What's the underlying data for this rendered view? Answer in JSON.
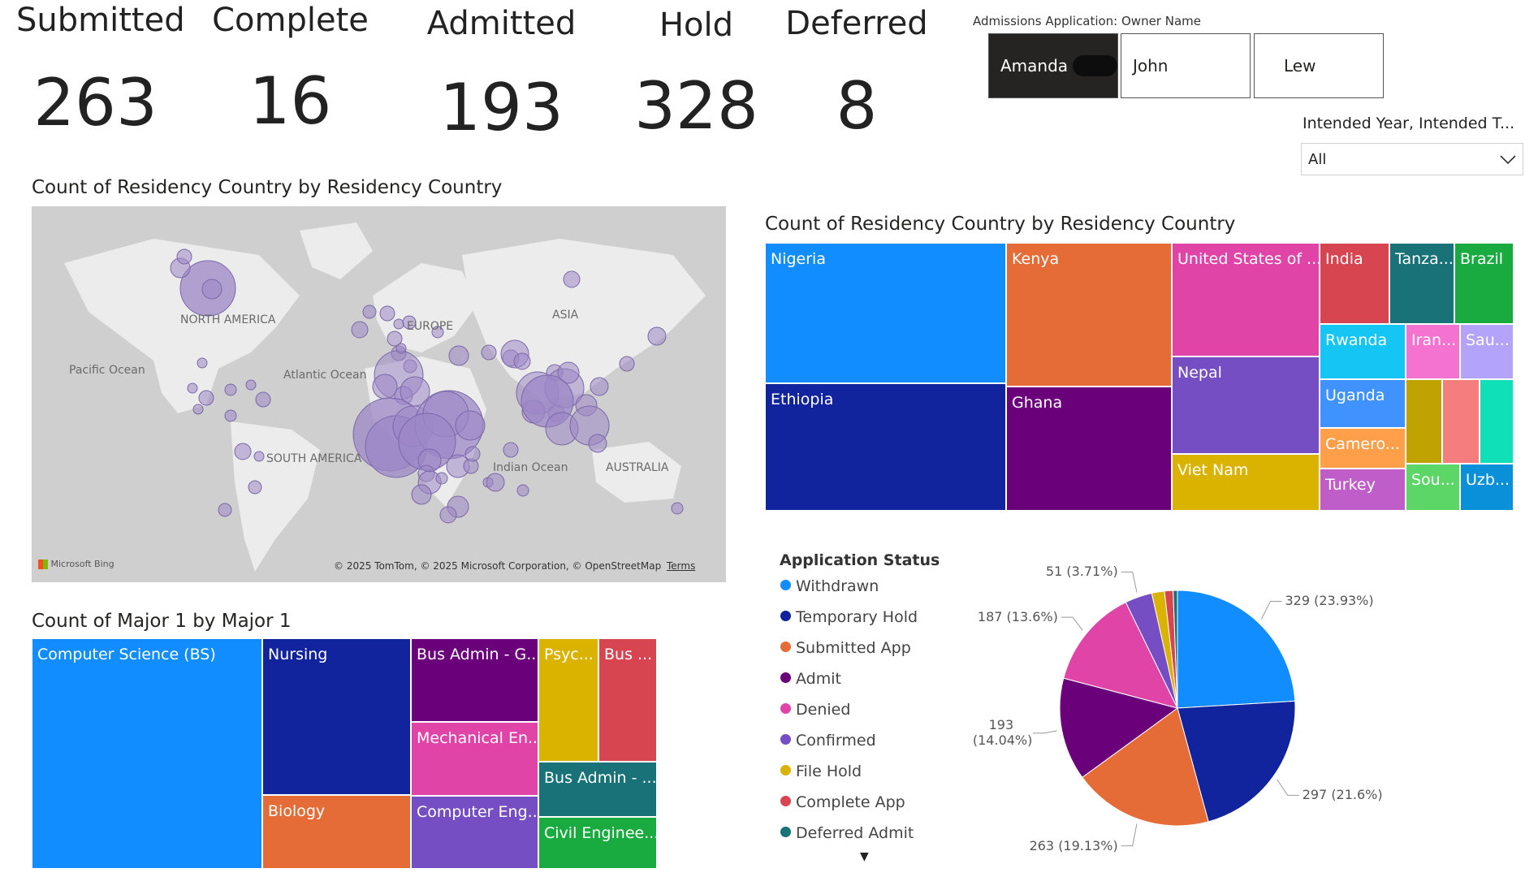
{
  "kpis": [
    {
      "label": "Submitted",
      "value": "263"
    },
    {
      "label": "Complete",
      "value": "16"
    },
    {
      "label": "Admitted",
      "value": "193"
    },
    {
      "label": "Hold",
      "value": "328"
    },
    {
      "label": "Deferred",
      "value": "8"
    }
  ],
  "owner_slicer": {
    "title": "Admissions Application: Owner Name",
    "options": [
      "Amanda",
      "John",
      "Lew"
    ],
    "selected": "Amanda"
  },
  "year_slicer": {
    "title": "Intended Year, Intended T...",
    "value": "All"
  },
  "map_visual": {
    "title": "Count of Residency Country by Residency Country",
    "labels": {
      "north_america": "NORTH AMERICA",
      "europe": "EUROPE",
      "asia": "ASIA",
      "pacific": "Pacific Ocean",
      "atlantic": "Atlantic Ocean",
      "south_america": "SOUTH AMERICA",
      "indian": "Indian Ocean",
      "australia": "AUSTRALIA"
    },
    "logo": "Microsoft Bing",
    "copyright": "© 2025 TomTom, © 2025 Microsoft Corporation, © OpenStreetMap",
    "terms": "Terms",
    "bubble_color": "#9c87c7"
  },
  "country_treemap": {
    "title": "Count of Residency Country by Residency Country",
    "tiles": [
      {
        "label": "Nigeria",
        "color": "#118dff"
      },
      {
        "label": "Ethiopia",
        "color": "#12239e"
      },
      {
        "label": "Kenya",
        "color": "#e66c37"
      },
      {
        "label": "Ghana",
        "color": "#6b007b"
      },
      {
        "label": "United States of ...",
        "color": "#e044a7"
      },
      {
        "label": "Nepal",
        "color": "#744ec2"
      },
      {
        "label": "Viet Nam",
        "color": "#d9b300"
      },
      {
        "label": "India",
        "color": "#d64550"
      },
      {
        "label": "Tanza...",
        "color": "#197278"
      },
      {
        "label": "Brazil",
        "color": "#1aab40"
      },
      {
        "label": "Rwanda",
        "color": "#15c6f4"
      },
      {
        "label": "Iran...",
        "color": "#f472d0"
      },
      {
        "label": "Sau...",
        "color": "#b3a4fa"
      },
      {
        "label": "Uganda",
        "color": "#4092ff"
      },
      {
        "label": "Camero...",
        "color": "#ff9f4a"
      },
      {
        "label": "Turkey",
        "color": "#c05ec9"
      },
      {
        "label": "",
        "color": "#c0a200"
      },
      {
        "label": "",
        "color": "#f57d7d"
      },
      {
        "label": "",
        "color": "#0fe0b8"
      },
      {
        "label": "Sou...",
        "color": "#5bd667"
      },
      {
        "label": "Uzb...",
        "color": "#0a8fd9"
      }
    ]
  },
  "major_treemap": {
    "title": "Count of Major 1 by Major 1",
    "tiles": [
      {
        "label": "Computer Science (BS)",
        "color": "#118dff"
      },
      {
        "label": "Nursing",
        "color": "#12239e"
      },
      {
        "label": "Biology",
        "color": "#e66c37"
      },
      {
        "label": "Bus Admin - G...",
        "color": "#6b007b"
      },
      {
        "label": "Mechanical En...",
        "color": "#e044a7"
      },
      {
        "label": "Computer Eng...",
        "color": "#744ec2"
      },
      {
        "label": "Psyc...",
        "color": "#d9b300"
      },
      {
        "label": "Bus ...",
        "color": "#d64550"
      },
      {
        "label": "Bus Admin - ...",
        "color": "#197278"
      },
      {
        "label": "Civil Enginee...",
        "color": "#1aab40"
      }
    ]
  },
  "status_legend": {
    "title": "Application Status",
    "items": [
      {
        "label": "Withdrawn",
        "color": "#118dff"
      },
      {
        "label": "Temporary Hold",
        "color": "#12239e"
      },
      {
        "label": "Submitted App",
        "color": "#e66c37"
      },
      {
        "label": "Admit",
        "color": "#6b007b"
      },
      {
        "label": "Denied",
        "color": "#e044a7"
      },
      {
        "label": "Confirmed",
        "color": "#744ec2"
      },
      {
        "label": "File Hold",
        "color": "#d9b300"
      },
      {
        "label": "Complete App",
        "color": "#d64550"
      },
      {
        "label": "Deferred Admit",
        "color": "#197278"
      }
    ],
    "more_icon": "▼"
  },
  "chart_data": {
    "type": "pie",
    "categories": [
      "Withdrawn",
      "Temporary Hold",
      "Submitted App",
      "Admit",
      "Denied",
      "Confirmed",
      "File Hold",
      "Complete App",
      "Deferred Admit"
    ],
    "values": [
      329,
      297,
      263,
      193,
      187,
      51,
      24,
      16,
      8
    ],
    "colors": [
      "#118dff",
      "#12239e",
      "#e66c37",
      "#6b007b",
      "#e044a7",
      "#744ec2",
      "#d9b300",
      "#d64550",
      "#197278"
    ],
    "data_labels": [
      "329 (23.93%)",
      "297 (21.6%)",
      "263 (19.13%)",
      "193 (14.04%)",
      "187 (13.6%)",
      "51 (3.71%)"
    ],
    "title": "",
    "legend": "left"
  }
}
